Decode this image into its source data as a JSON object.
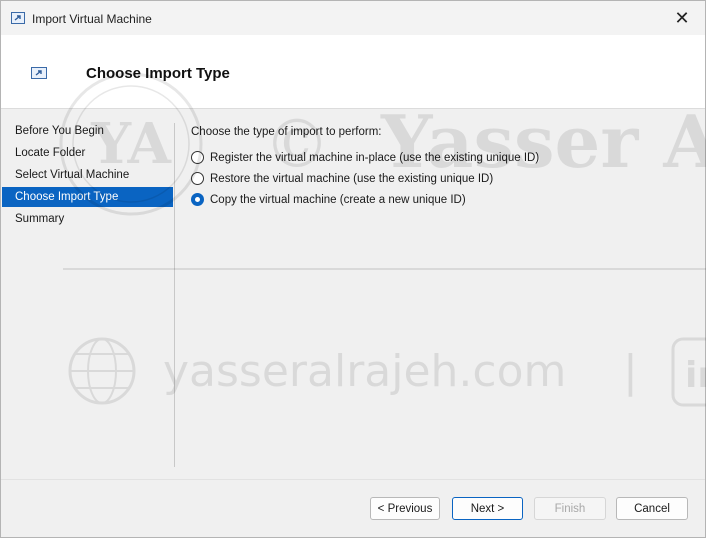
{
  "window": {
    "title": "Import Virtual Machine",
    "close_glyph": "✕"
  },
  "header": {
    "title": "Choose Import Type"
  },
  "nav": {
    "items": [
      {
        "label": "Before You Begin",
        "selected": false
      },
      {
        "label": "Locate Folder",
        "selected": false
      },
      {
        "label": "Select Virtual Machine",
        "selected": false
      },
      {
        "label": "Choose Import Type",
        "selected": true
      },
      {
        "label": "Summary",
        "selected": false
      }
    ]
  },
  "content": {
    "prompt": "Choose the type of import to perform:",
    "options": [
      {
        "label": "Register the virtual machine in-place (use the existing unique ID)",
        "checked": false
      },
      {
        "label": "Restore the virtual machine (use the existing unique ID)",
        "checked": false
      },
      {
        "label": "Copy the virtual machine (create a new unique ID)",
        "checked": true
      }
    ]
  },
  "buttons": {
    "previous": "< Previous",
    "next": "Next >",
    "finish": "Finish",
    "cancel": "Cancel"
  },
  "watermark": {
    "initials": "YA",
    "copyright": "©",
    "name": "Yasser A",
    "site": "yasseralrajeh.com",
    "separator": "|",
    "linkedin": "in"
  },
  "colors": {
    "accent": "#0a64c2",
    "window_bg": "#f0f0f0",
    "header_bg": "#ffffff"
  }
}
